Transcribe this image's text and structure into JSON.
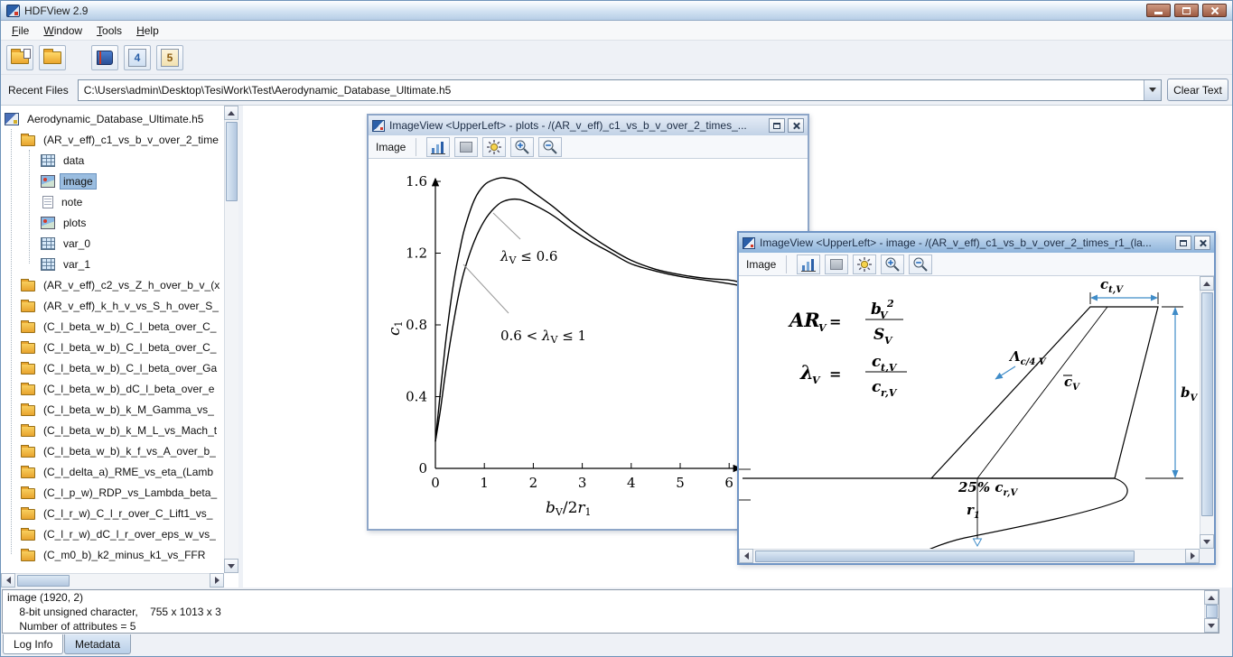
{
  "window": {
    "title": "HDFView 2.9"
  },
  "menubar": {
    "items": [
      {
        "m": "F",
        "rest": "ile"
      },
      {
        "m": "W",
        "rest": "indow"
      },
      {
        "m": "T",
        "rest": "ools"
      },
      {
        "m": "H",
        "rest": "elp"
      }
    ]
  },
  "toolbar": {
    "hdf4_glyph": "4",
    "hdf5_glyph": "5"
  },
  "recent": {
    "label": "Recent Files",
    "path": "C:\\Users\\admin\\Desktop\\TesiWork\\Test\\Aerodynamic_Database_Ultimate.h5",
    "clear_label": "Clear Text"
  },
  "tree": {
    "root": "Aerodynamic_Database_Ultimate.h5",
    "expanded_group": "(AR_v_eff)_c1_vs_b_v_over_2_time",
    "children": [
      "data",
      "image",
      "note",
      "plots",
      "var_0",
      "var_1"
    ],
    "selected_child": "image",
    "groups": [
      "(AR_v_eff)_c2_vs_Z_h_over_b_v_(x",
      "(AR_v_eff)_k_h_v_vs_S_h_over_S_",
      "(C_l_beta_w_b)_C_l_beta_over_C_",
      "(C_l_beta_w_b)_C_l_beta_over_C_",
      "(C_l_beta_w_b)_C_l_beta_over_Ga",
      "(C_l_beta_w_b)_dC_l_beta_over_e",
      "(C_l_beta_w_b)_k_M_Gamma_vs_",
      "(C_l_beta_w_b)_k_M_L_vs_Mach_t",
      "(C_l_beta_w_b)_k_f_vs_A_over_b_",
      "(C_l_delta_a)_RME_vs_eta_(Lamb",
      "(C_l_p_w)_RDP_vs_Lambda_beta_",
      "(C_l_r_w)_C_l_r_over_C_Lift1_vs_",
      "(C_l_r_w)_dC_l_r_over_eps_w_vs_",
      "(C_m0_b)_k2_minus_k1_vs_FFR"
    ]
  },
  "frames": {
    "plots": {
      "title": "ImageView <UpperLeft>  -  plots  -  /(AR_v_eff)_c1_vs_b_v_over_2_times_...",
      "menu_label": "Image"
    },
    "image": {
      "title": "ImageView <UpperLeft>  -  image  -  /(AR_v_eff)_c1_vs_b_v_over_2_times_r1_(la...",
      "menu_label": "Image"
    }
  },
  "chart_data": {
    "type": "line",
    "title": "",
    "xlabel": "b_V/2r_1",
    "ylabel": "c_1",
    "xlim": [
      0,
      6.2
    ],
    "ylim": [
      0,
      1.7
    ],
    "xticks": [
      0,
      1,
      2,
      3,
      4,
      5,
      6
    ],
    "yticks": [
      0,
      0.4,
      0.8,
      1.2,
      1.6
    ],
    "grid": false,
    "legend": "inline annotations",
    "series": [
      {
        "name": "λV ≤ 0.6",
        "x": [
          0,
          0.1,
          0.2,
          0.3,
          0.4,
          0.5,
          0.6,
          0.8,
          1.0,
          1.2,
          1.4,
          1.7,
          2.0,
          2.4,
          2.8,
          3.2,
          3.6,
          4.0,
          4.5,
          5.0,
          5.5,
          6.0,
          6.2
        ],
        "y": [
          0.15,
          0.42,
          0.68,
          0.9,
          1.08,
          1.22,
          1.34,
          1.5,
          1.58,
          1.61,
          1.62,
          1.6,
          1.54,
          1.46,
          1.37,
          1.29,
          1.22,
          1.16,
          1.11,
          1.08,
          1.06,
          1.05,
          1.04
        ]
      },
      {
        "name": "0.6 < λV ≤ 1",
        "x": [
          0,
          0.1,
          0.2,
          0.3,
          0.4,
          0.5,
          0.6,
          0.8,
          1.0,
          1.2,
          1.4,
          1.7,
          2.0,
          2.4,
          2.8,
          3.2,
          3.6,
          4.0,
          4.5,
          5.0,
          5.5,
          6.0,
          6.2
        ],
        "y": [
          0.15,
          0.32,
          0.52,
          0.7,
          0.86,
          1.0,
          1.11,
          1.27,
          1.38,
          1.45,
          1.49,
          1.5,
          1.47,
          1.41,
          1.33,
          1.26,
          1.2,
          1.14,
          1.1,
          1.07,
          1.05,
          1.03,
          1.02
        ]
      }
    ]
  },
  "plot_labels": {
    "y_main": "c",
    "y_sub": "1",
    "x_main": "b",
    "x_sub": "V",
    "x_mid": "/2",
    "x_r": "r",
    "x_rsub": "1",
    "ann1_lam": "λ",
    "ann1_sub": "V",
    "ann1_rest": " ≤ 0.6",
    "ann2_pre": "0.6 < ",
    "ann2_lam": "λ",
    "ann2_sub": "V",
    "ann2_rest": " ≤ 1"
  },
  "figure": {
    "ar": "AR",
    "ar_sub": "V",
    "eq": "=",
    "ar_num": "b",
    "ar_num_sub": "V",
    "ar_num_sup": "2",
    "ar_den": "S",
    "ar_den_sub": "V",
    "lam": "λ",
    "lam_sub": "V",
    "lam_num": "c",
    "lam_num_sub": "t,V",
    "lam_den": "c",
    "lam_den_sub": "r,V",
    "ct": "c",
    "ct_sub": "t,V",
    "bv": "b",
    "bv_sub": "V",
    "sweep": "Λ",
    "sweep_sub": "c/4,V",
    "mac": "c",
    "mac_sub": "V",
    "root_pct": "25% c",
    "root_pct_sub": "r,V",
    "r1": "r",
    "r1_sub": "1"
  },
  "status": {
    "lines": [
      "image (1920, 2)",
      "    8-bit unsigned character,    755 x 1013 x 3",
      "    Number of attributes = 5"
    ]
  },
  "bottom_tabs": [
    {
      "label": "Log Info",
      "selected": true
    },
    {
      "label": "Metadata",
      "selected": false
    }
  ]
}
